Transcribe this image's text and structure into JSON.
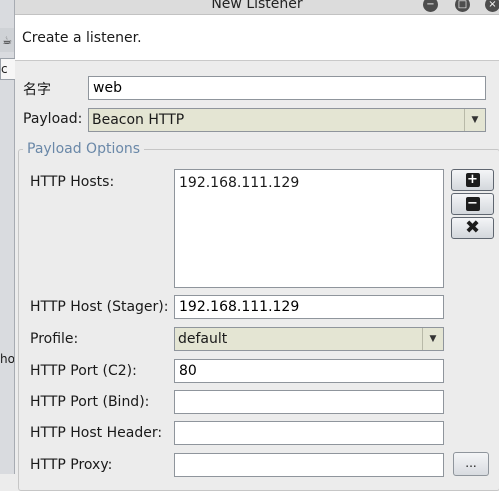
{
  "window": {
    "title": "New Listener"
  },
  "description": "Create a listener.",
  "name": {
    "label": "名字",
    "value": "web"
  },
  "payload": {
    "label": "Payload:",
    "value": "Beacon HTTP"
  },
  "payload_options": {
    "title": "Payload Options",
    "http_hosts": {
      "label": "HTTP Hosts:",
      "items": [
        "192.168.111.129"
      ]
    },
    "http_host_stager": {
      "label": "HTTP Host (Stager):",
      "value": "192.168.111.129"
    },
    "profile": {
      "label": "Profile:",
      "value": "default"
    },
    "http_port_c2": {
      "label": "HTTP Port (C2):",
      "value": "80"
    },
    "http_port_bind": {
      "label": "HTTP Port (Bind):",
      "value": ""
    },
    "http_host_header": {
      "label": "HTTP Host Header:",
      "value": ""
    },
    "http_proxy": {
      "label": "HTTP Proxy:",
      "value": "",
      "browse_label": "..."
    }
  },
  "background": {
    "field_text": "c",
    "side_text": "hos"
  }
}
